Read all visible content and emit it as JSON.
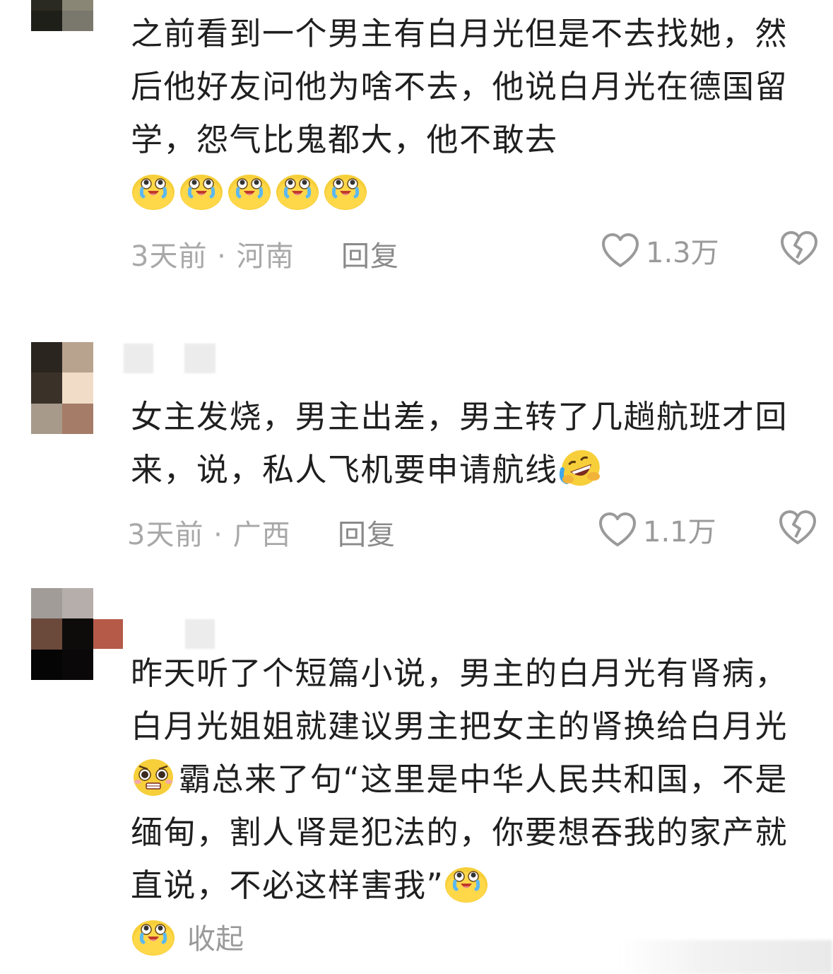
{
  "comments": [
    {
      "text": "之前看到一个男主有白月光但是不去找她，然后他好友问他为啥不去，他说白月光在德国留学，怨气比鬼都大，他不敢去",
      "trailing_emoji": [
        "crying-laughing-emoji",
        "crying-laughing-emoji",
        "crying-laughing-emoji",
        "crying-laughing-emoji",
        "crying-laughing-emoji"
      ],
      "time": "3天前",
      "location": "河南",
      "time_location": "3天前 · 河南",
      "reply_label": "回复",
      "likes": "1.3万"
    },
    {
      "text": "女主发烧，男主出差，男主转了几趟航班才回来，说，私人飞机要申请航线",
      "trailing_emoji": [
        "rofl-emoji"
      ],
      "time": "3天前",
      "location": "广西",
      "time_location": "3天前 · 广西",
      "reply_label": "回复",
      "likes": "1.1万"
    },
    {
      "text_part1": "昨天听了个短篇小说，男主的白月光有肾病，白月光姐姐就建议男主把女主的肾换给白月光",
      "inline_emoji": "pleading-emoji",
      "text_part2": "霸总来了句“这里是中华人民共和国，不是缅甸，割人肾是犯法的，你要想吞我的家产就直说，不必这样害我”",
      "trailing_emoji": [
        "crying-laughing-emoji"
      ],
      "collapse_label": "收起"
    }
  ],
  "colors": {
    "text": "#1f1f1f",
    "meta": "#a8a8a8",
    "icon": "#9a9a9a",
    "emoji_yellow": "#f7cf3a"
  }
}
